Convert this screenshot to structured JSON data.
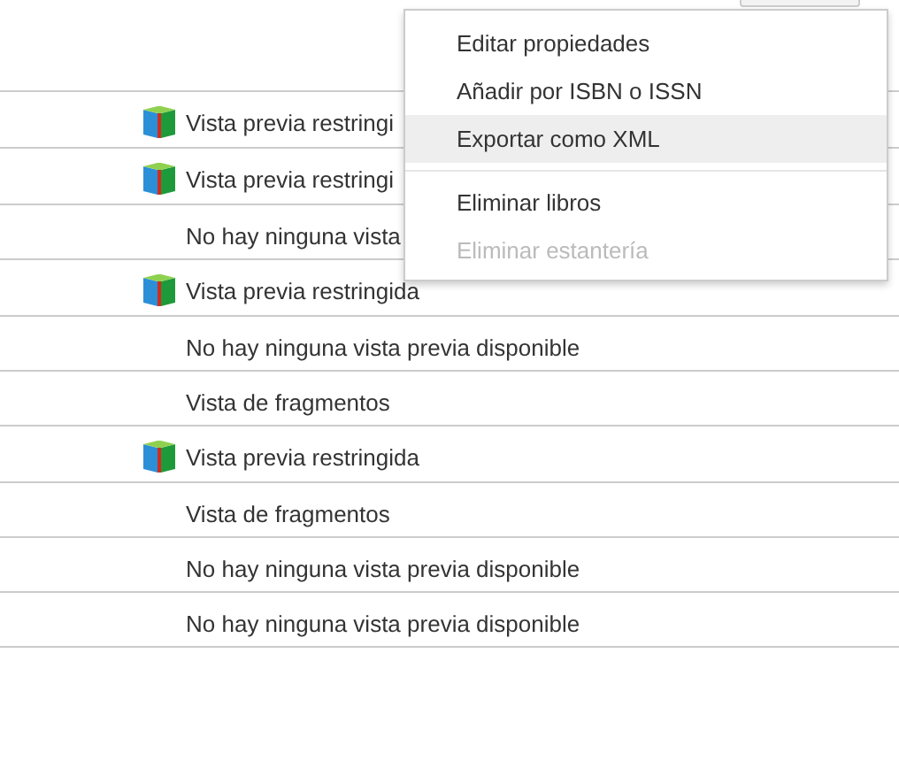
{
  "rows": [
    {
      "has_icon": true,
      "preview": "Vista previa restringi"
    },
    {
      "has_icon": true,
      "preview": "Vista previa restringi"
    },
    {
      "has_icon": false,
      "preview": "No hay ninguna vista"
    },
    {
      "has_icon": true,
      "preview": "Vista previa restringida"
    },
    {
      "has_icon": false,
      "preview": "No hay ninguna vista previa disponible"
    },
    {
      "has_icon": false,
      "preview": "Vista de fragmentos"
    },
    {
      "has_icon": true,
      "preview": "Vista previa restringida"
    },
    {
      "has_icon": false,
      "preview": "Vista de fragmentos"
    },
    {
      "has_icon": false,
      "preview": "No hay ninguna vista previa disponible"
    },
    {
      "has_icon": false,
      "preview": "No hay ninguna vista previa disponible"
    }
  ],
  "menu": {
    "items": [
      {
        "kind": "item",
        "label": "Editar propiedades",
        "selected": false,
        "disabled": false
      },
      {
        "kind": "item",
        "label": "Añadir por ISBN o ISSN",
        "selected": false,
        "disabled": false
      },
      {
        "kind": "item",
        "label": "Exportar como XML",
        "selected": true,
        "disabled": false
      },
      {
        "kind": "separator"
      },
      {
        "kind": "item",
        "label": "Eliminar libros",
        "selected": false,
        "disabled": false
      },
      {
        "kind": "item",
        "label": "Eliminar estantería",
        "selected": false,
        "disabled": true
      }
    ]
  }
}
